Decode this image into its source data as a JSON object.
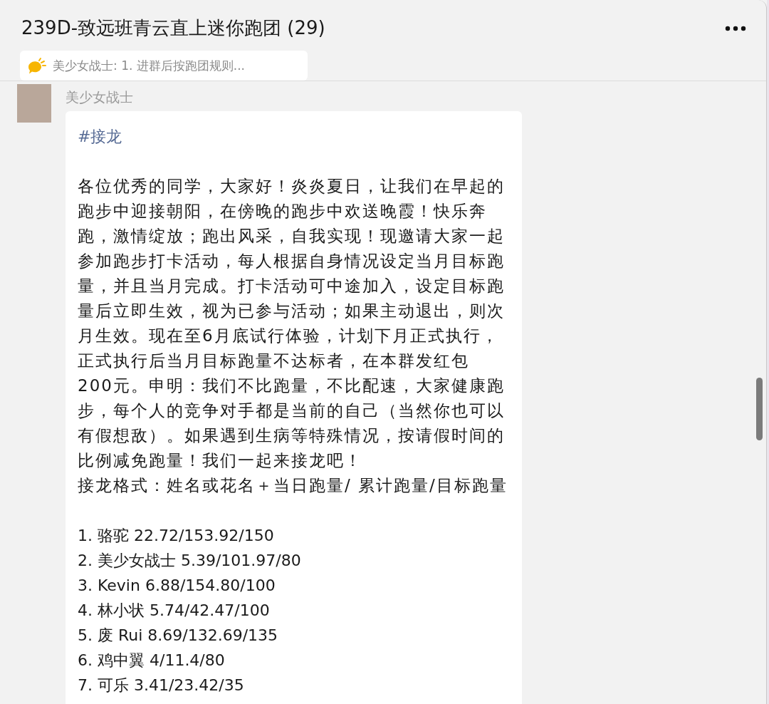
{
  "chat": {
    "title": "239D-致远班青云直上迷你跑团 (29)"
  },
  "pinned_notice": {
    "text": "美少女战士: 1. 进群后按跑团规则..."
  },
  "message": {
    "sender": "美少女战士",
    "tag": "#接龙",
    "paragraphs": [
      "各位优秀的同学，大家好！炎炎夏日，让我们在早起的跑步中迎接朝阳，在傍晚的跑步中欢送晚霞！快乐奔跑，激情绽放；跑出风采，自我实现！现邀请大家一起参加跑步打卡活动，每人根据自身情况设定当月目标跑量，并且当月完成。打卡活动可中途加入，设定目标跑量后立即生效，视为已参与活动；如果主动退出，则次月生效。现在至6月底试行体验，计划下月正式执行，正式执行后当月目标跑量不达标者，在本群发红包 200元。申明：我们不比跑量，不比配速，大家健康跑步，每个人的竞争对手都是当前的自己（当然你也可以有假想敌）。如果遇到生病等特殊情况，按请假时间的比例减免跑量！我们一起来接龙吧！",
      "接龙格式：姓名或花名＋当日跑量/ 累计跑量/目标跑量"
    ],
    "entries": [
      "1. 骆驼  22.72/153.92/150",
      "2. 美少女战士 5.39/101.97/80",
      "3. Kevin 6.88/154.80/100",
      "4. 林小状 5.74/42.47/100",
      "5. 废 Rui  8.69/132.69/135",
      "6. 鸡中翼 4/11.4/80",
      "7. 可乐 3.41/23.42/35"
    ]
  }
}
